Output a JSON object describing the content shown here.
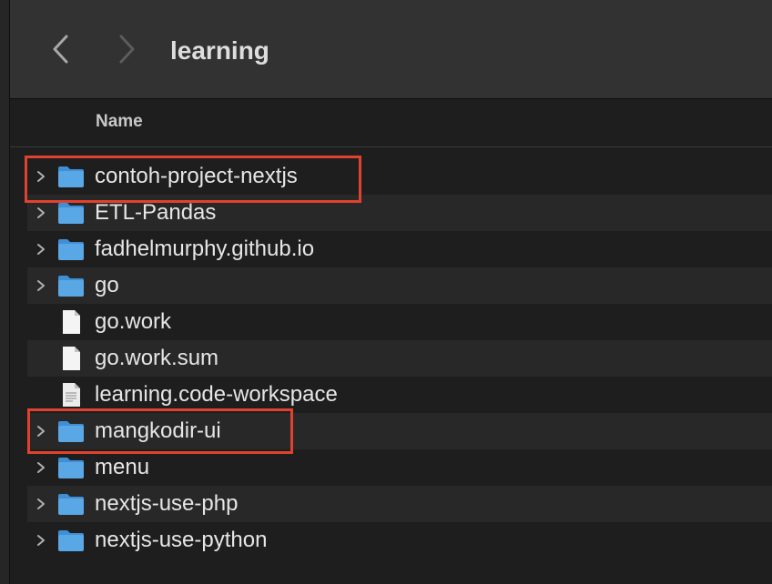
{
  "window": {
    "title": "learning"
  },
  "toolbar": {
    "back_icon": "chevron-left-icon",
    "forward_icon": "chevron-right-icon"
  },
  "columns": {
    "name": "Name"
  },
  "colors": {
    "folder": "#5aa7e6",
    "highlight": "#e0422e"
  },
  "items": [
    {
      "label": "contoh-project-nextjs",
      "kind": "folder",
      "expandable": true,
      "highlighted": true
    },
    {
      "label": "ETL-Pandas",
      "kind": "folder",
      "expandable": true,
      "highlighted": false
    },
    {
      "label": "fadhelmurphy.github.io",
      "kind": "folder",
      "expandable": true,
      "highlighted": false
    },
    {
      "label": "go",
      "kind": "folder",
      "expandable": true,
      "highlighted": false
    },
    {
      "label": "go.work",
      "kind": "file",
      "expandable": false,
      "highlighted": false
    },
    {
      "label": "go.work.sum",
      "kind": "file",
      "expandable": false,
      "highlighted": false
    },
    {
      "label": "learning.code-workspace",
      "kind": "text-file",
      "expandable": false,
      "highlighted": false
    },
    {
      "label": "mangkodir-ui",
      "kind": "folder",
      "expandable": true,
      "highlighted": true
    },
    {
      "label": "menu",
      "kind": "folder",
      "expandable": true,
      "highlighted": false
    },
    {
      "label": "nextjs-use-php",
      "kind": "folder",
      "expandable": true,
      "highlighted": false
    },
    {
      "label": "nextjs-use-python",
      "kind": "folder",
      "expandable": true,
      "highlighted": false
    }
  ]
}
